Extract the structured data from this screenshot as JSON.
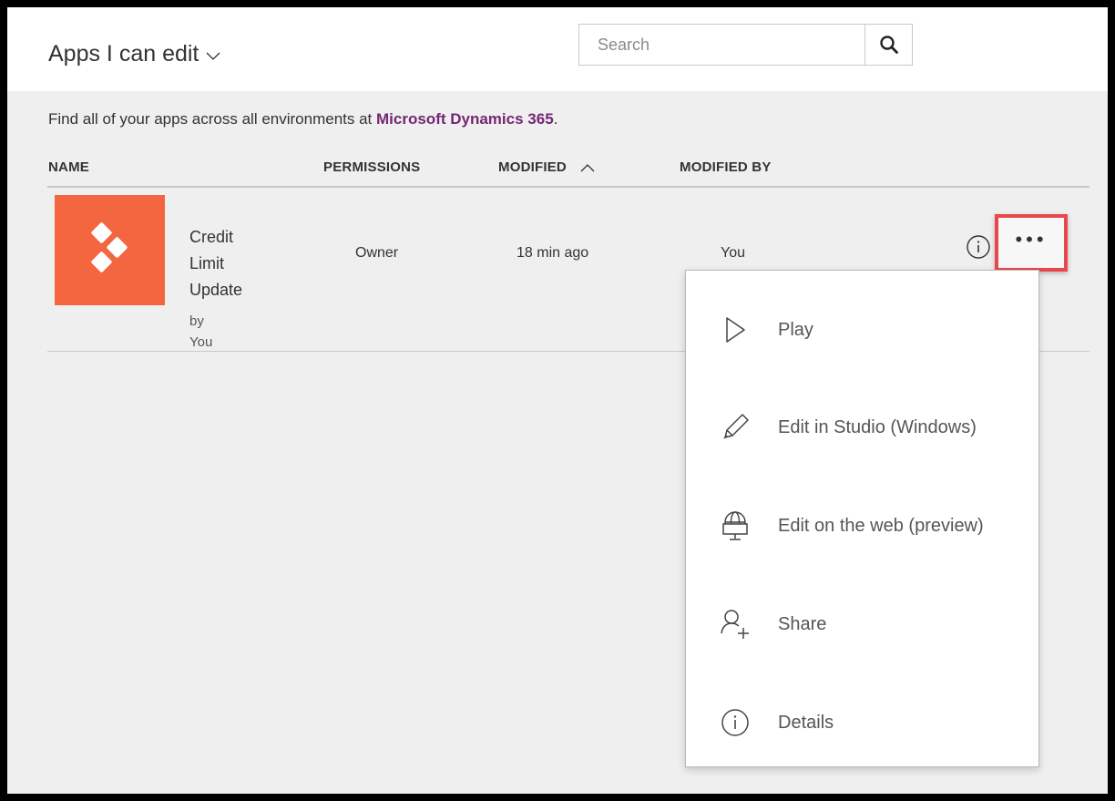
{
  "header": {
    "title": "Apps I can edit",
    "search_placeholder": "Search"
  },
  "info": {
    "prefix": "Find all of your apps across all environments at ",
    "link": "Microsoft Dynamics 365",
    "suffix": "."
  },
  "columns": {
    "name": "NAME",
    "permissions": "PERMISSIONS",
    "modified": "MODIFIED",
    "modified_by": "MODIFIED BY"
  },
  "app": {
    "name_line1": "Credit",
    "name_line2": "Limit",
    "name_line3": "Update",
    "by_label": "by",
    "author": "You",
    "permissions": "Owner",
    "modified": "18 min ago",
    "modified_by": "You",
    "tile_color": "#f3663f"
  },
  "menu": {
    "items": [
      {
        "label": "Play",
        "icon": "play-icon"
      },
      {
        "label": "Edit in Studio (Windows)",
        "icon": "pencil-icon"
      },
      {
        "label": "Edit on the web (preview)",
        "icon": "globe-monitor-icon"
      },
      {
        "label": "Share",
        "icon": "add-person-icon"
      },
      {
        "label": "Details",
        "icon": "info-icon"
      }
    ]
  },
  "colors": {
    "link": "#742774",
    "highlight": "#e8474b"
  }
}
